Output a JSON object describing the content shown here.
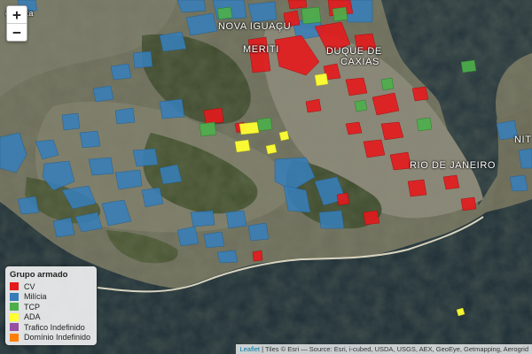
{
  "map": {
    "zoom_in": "+",
    "zoom_out": "−",
    "labels": {
      "nova_iguacu": "NOVA IGUAÇU",
      "meriti": "MERITI",
      "duque_de_caxias_1": "DUQUE DE",
      "duque_de_caxias_2": "CAXIAS",
      "rio_de_janeiro": "RIO DE JANEIRO",
      "nit": "NIT",
      "top_left": "epedita"
    }
  },
  "legend": {
    "title": "Grupo armado",
    "items": [
      {
        "label": "CV",
        "color": "#e41a1c"
      },
      {
        "label": "Milícia",
        "color": "#377eb8"
      },
      {
        "label": "TCP",
        "color": "#4daf4a"
      },
      {
        "label": "ADA",
        "color": "#ffff33"
      },
      {
        "label": "Trafico Indefinido",
        "color": "#984ea3"
      },
      {
        "label": "Domínio Indefinido",
        "color": "#ff7f00"
      }
    ]
  },
  "attribution": {
    "leaflet": "Leaflet",
    "text": " | Tiles © Esri — Source: Esri, i-cubed, USDA, USGS, AEX, GeoEye, Getmapping, Aerogrid"
  }
}
